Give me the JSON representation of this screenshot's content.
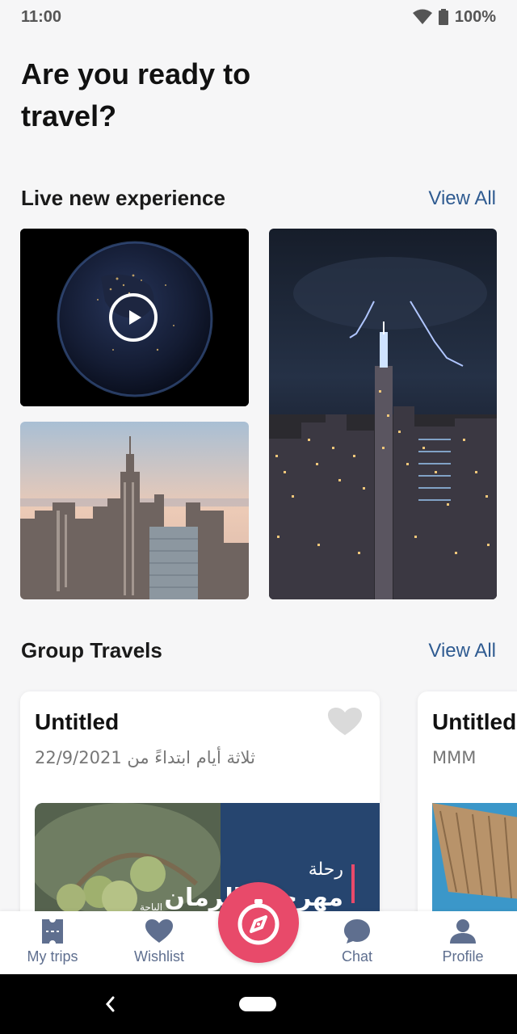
{
  "status": {
    "time": "11:00",
    "battery": "100%"
  },
  "page": {
    "title": "Are you ready to travel?"
  },
  "experience": {
    "title": "Live new experience",
    "view_all": "View All"
  },
  "group": {
    "title": "Group Travels",
    "view_all": "View All",
    "cards": [
      {
        "title": "Untitled",
        "subtitle": "ثلاثة أيام ابتداءً من 22/9/2021",
        "image_text_top": "رحلة",
        "image_text_main": "مهرجان الرمان",
        "image_text_small": "الباحة"
      },
      {
        "title": "Untitled",
        "subtitle": "MMM"
      }
    ]
  },
  "nav": {
    "items": [
      {
        "label": "My trips",
        "icon": "ticket-icon"
      },
      {
        "label": "Wishlist",
        "icon": "heart-icon"
      },
      {
        "label": "Chat",
        "icon": "chat-bubble-icon"
      },
      {
        "label": "Profile",
        "icon": "person-icon"
      }
    ],
    "fab_icon": "compass-icon"
  },
  "colors": {
    "accent": "#e84a6a",
    "link": "#2f5b91",
    "nav": "#5f6f8f"
  }
}
